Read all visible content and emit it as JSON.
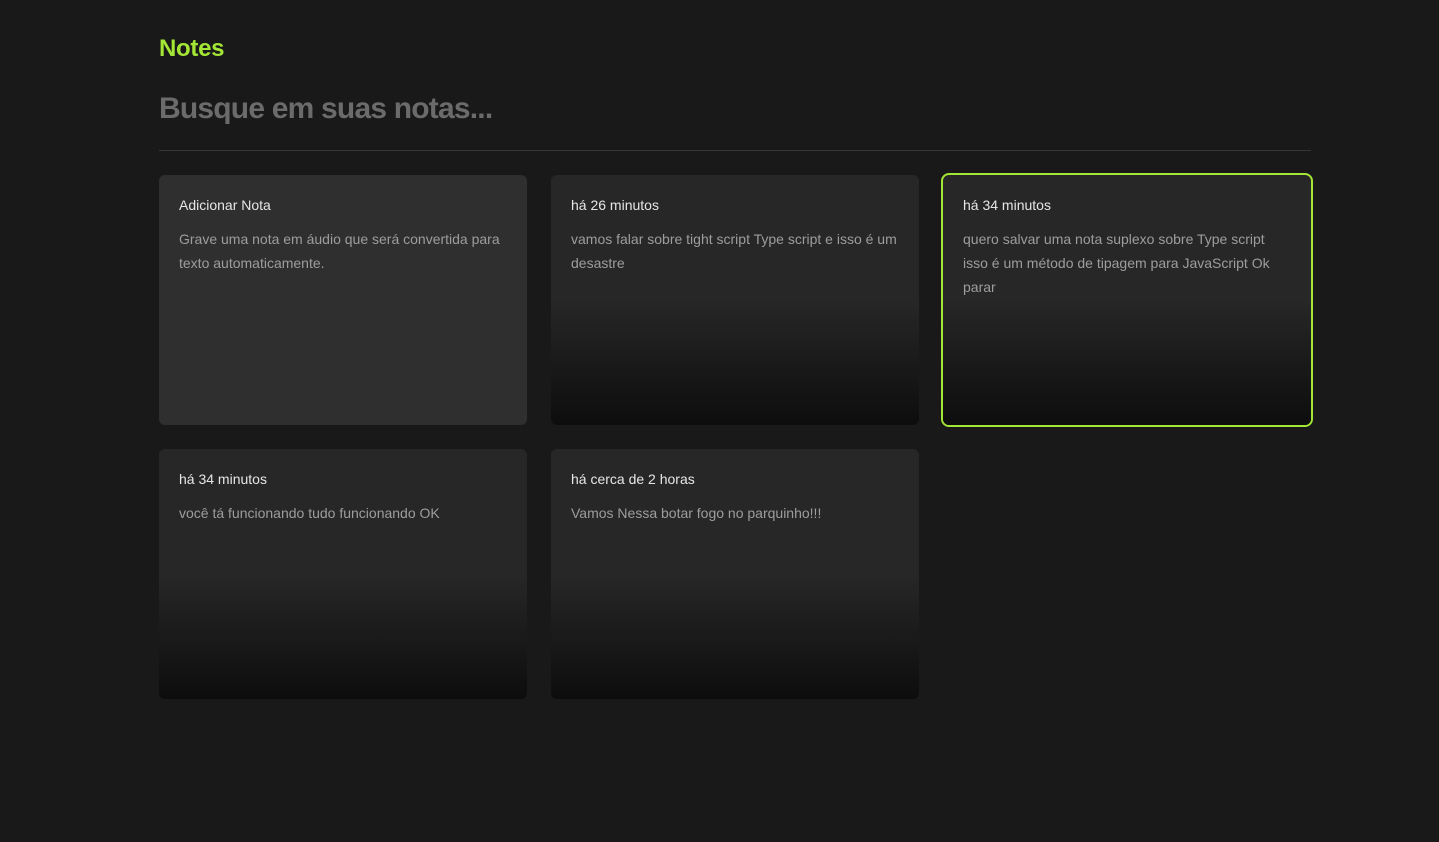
{
  "header": {
    "logo": "Notes"
  },
  "search": {
    "placeholder": "Busque em suas notas..."
  },
  "add_card": {
    "title": "Adicionar Nota",
    "description": "Grave uma nota em áudio que será convertida para texto automaticamente."
  },
  "notes": [
    {
      "date": "há 26 minutos",
      "content": "vamos falar sobre tight script Type script e isso é um desastre"
    },
    {
      "date": "há 34 minutos",
      "content": "quero salvar uma nota suplexo sobre Type script isso é um método de tipagem para JavaScript Ok parar"
    },
    {
      "date": "há 34 minutos",
      "content": "você tá funcionando tudo funcionando OK"
    },
    {
      "date": "há cerca de 2 horas",
      "content": "Vamos Nessa botar fogo no parquinho!!!"
    }
  ],
  "colors": {
    "accent": "#a3e635",
    "background": "#191919",
    "card": "#272727"
  }
}
